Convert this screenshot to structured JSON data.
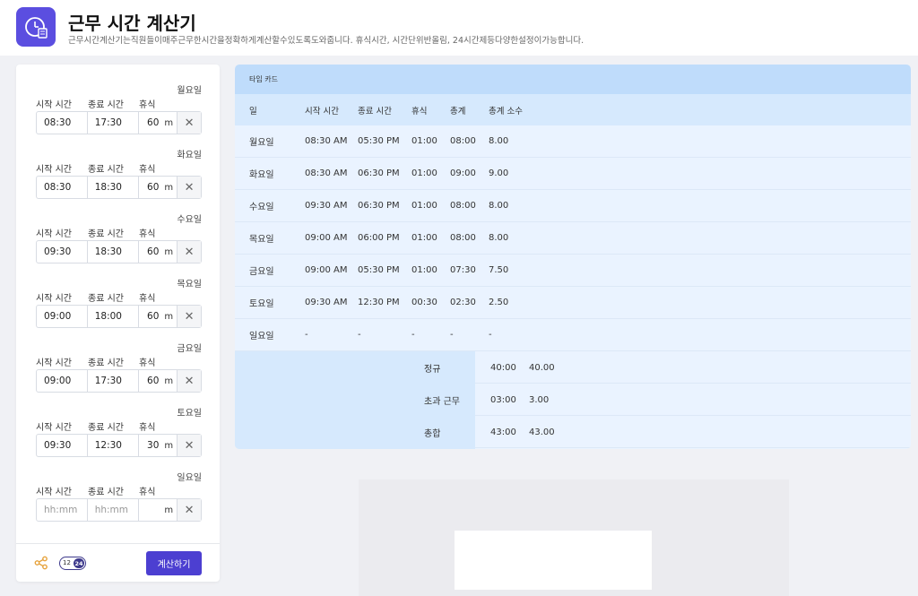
{
  "header": {
    "title": "근무 시간 계산기",
    "description": "근무시간계산기는직원들이매주근무한시간을정확하게계산할수있도록도와줍니다. 휴식시간, 시간단위반올림, 24시간제등다양한설정이가능합니다."
  },
  "labels": {
    "start": "시작 시간",
    "end": "종료 시간",
    "break": "휴식",
    "break_unit": "m"
  },
  "days": [
    {
      "name": "월요일",
      "start": "08:30",
      "end": "17:30",
      "break": "60"
    },
    {
      "name": "화요일",
      "start": "08:30",
      "end": "18:30",
      "break": "60"
    },
    {
      "name": "수요일",
      "start": "09:30",
      "end": "18:30",
      "break": "60"
    },
    {
      "name": "목요일",
      "start": "09:00",
      "end": "18:00",
      "break": "60"
    },
    {
      "name": "금요일",
      "start": "09:00",
      "end": "17:30",
      "break": "60"
    },
    {
      "name": "토요일",
      "start": "09:30",
      "end": "12:30",
      "break": "30"
    },
    {
      "name": "일요일",
      "start": "",
      "end": "",
      "break": "",
      "placeholder": "hh:mm"
    }
  ],
  "toggle": {
    "left": "12",
    "right": "24"
  },
  "calc_button": "계산하기",
  "timecard": {
    "title": "타임 카드",
    "headers": [
      "일",
      "시작 시간",
      "종료 시간",
      "휴식",
      "총계",
      "총계 소수"
    ],
    "rows": [
      [
        "월요일",
        "08:30 AM",
        "05:30 PM",
        "01:00",
        "08:00",
        "8.00"
      ],
      [
        "화요일",
        "08:30 AM",
        "06:30 PM",
        "01:00",
        "09:00",
        "9.00"
      ],
      [
        "수요일",
        "09:30 AM",
        "06:30 PM",
        "01:00",
        "08:00",
        "8.00"
      ],
      [
        "목요일",
        "09:00 AM",
        "06:00 PM",
        "01:00",
        "08:00",
        "8.00"
      ],
      [
        "금요일",
        "09:00 AM",
        "05:30 PM",
        "01:00",
        "07:30",
        "7.50"
      ],
      [
        "토요일",
        "09:30 AM",
        "12:30 PM",
        "00:30",
        "02:30",
        "2.50"
      ],
      [
        "일요일",
        "-",
        "-",
        "-",
        "-",
        "-"
      ]
    ],
    "summary": [
      {
        "label": "정규",
        "time": "40:00",
        "decimal": "40.00"
      },
      {
        "label": "초과 근무",
        "time": "03:00",
        "decimal": "3.00"
      },
      {
        "label": "총합",
        "time": "43:00",
        "decimal": "43.00"
      }
    ]
  },
  "colors": {
    "accent": "#4c3fd1",
    "header_bg": "#bfdcfb",
    "table_bg": "#eaf3ff"
  }
}
